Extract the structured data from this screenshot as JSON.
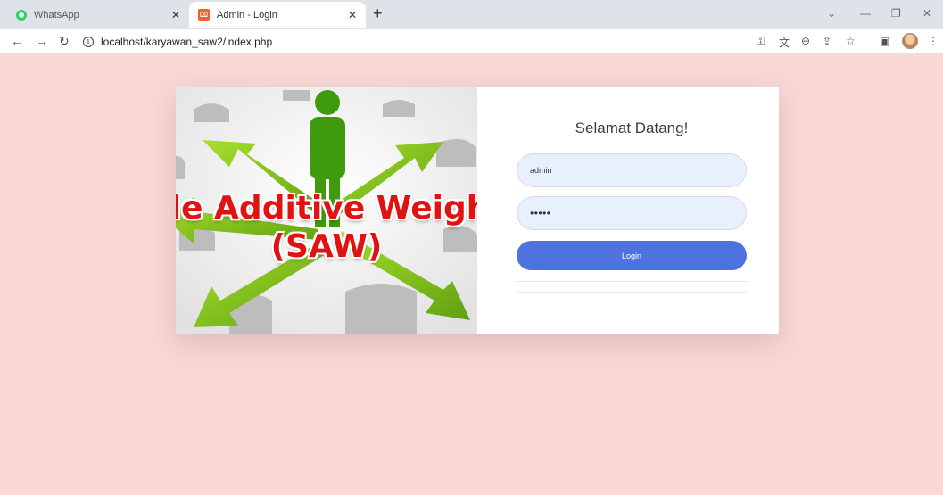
{
  "browser": {
    "tabs": [
      {
        "title": "WhatsApp",
        "active": false
      },
      {
        "title": "Admin - Login",
        "active": true
      }
    ],
    "new_tab_label": "+",
    "url": "localhost/karyawan_saw2/index.php"
  },
  "hero": {
    "line1": "ple Additive Weigh",
    "line2": "(SAW)"
  },
  "login": {
    "title": "Selamat Datang!",
    "username_value": "admin",
    "password_value": "•••••",
    "button_label": "Login"
  },
  "colors": {
    "page_bg": "#f8d7d5",
    "primary": "#4e73df",
    "input_bg": "#e8f0fe",
    "hero_text": "#e01212",
    "arrow_green": "#7cc219"
  }
}
